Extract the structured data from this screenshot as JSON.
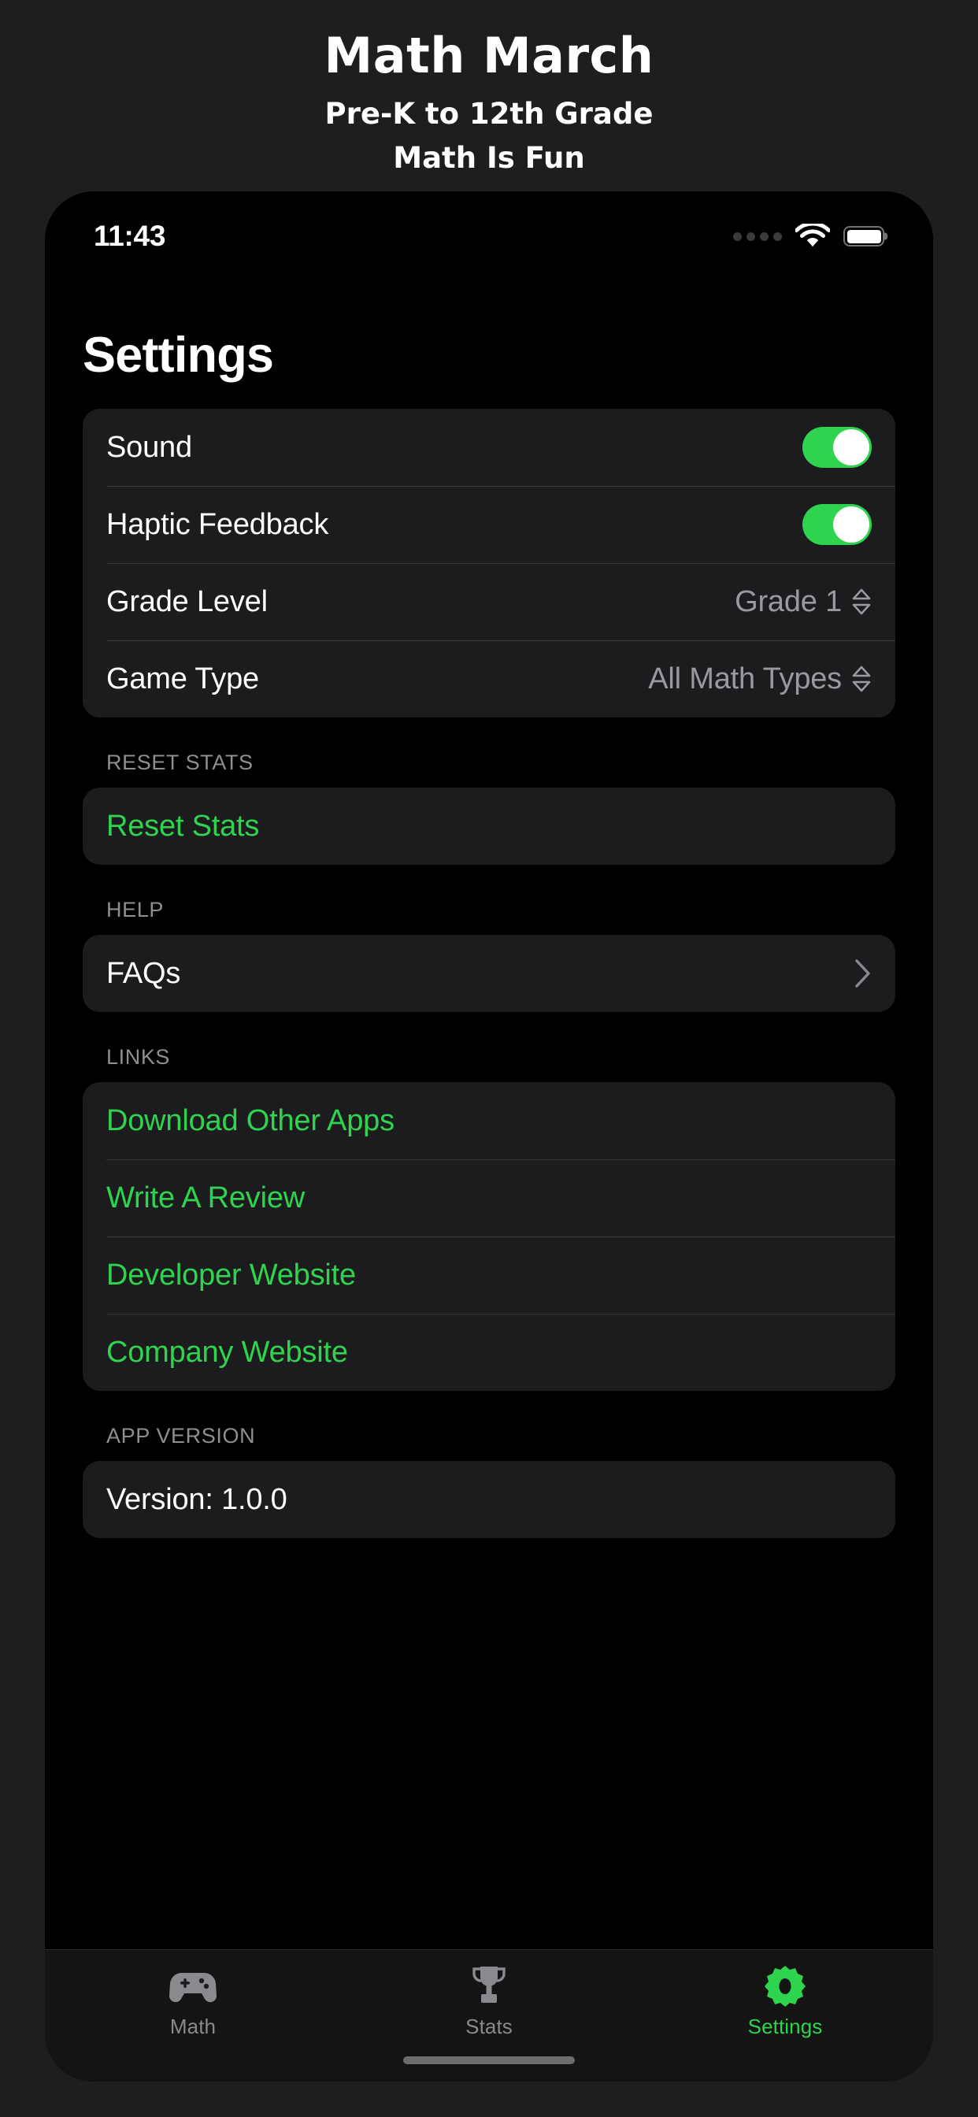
{
  "promo": {
    "title": "Math March",
    "subtitle_line1": "Pre-K to 12th Grade",
    "subtitle_line2": "Math Is Fun"
  },
  "statusbar": {
    "time": "11:43",
    "signal_icon": "cellular-signal-icon",
    "wifi_icon": "wifi-icon",
    "battery_icon": "battery-full-icon"
  },
  "screen": {
    "title": "Settings"
  },
  "settings_card": {
    "rows": [
      {
        "label": "Sound",
        "type": "toggle",
        "value": "on"
      },
      {
        "label": "Haptic Feedback",
        "type": "toggle",
        "value": "on"
      },
      {
        "label": "Grade Level",
        "type": "picker",
        "value": "Grade 1"
      },
      {
        "label": "Game Type",
        "type": "picker",
        "value": "All Math Types"
      }
    ]
  },
  "reset_section": {
    "header": "RESET STATS",
    "rows": [
      {
        "label": "Reset Stats"
      }
    ]
  },
  "help_section": {
    "header": "HELP",
    "rows": [
      {
        "label": "FAQs"
      }
    ]
  },
  "links_section": {
    "header": "LINKS",
    "rows": [
      {
        "label": "Download Other Apps"
      },
      {
        "label": "Write A Review"
      },
      {
        "label": "Developer Website"
      },
      {
        "label": "Company Website"
      }
    ]
  },
  "version_section": {
    "header": "APP VERSION",
    "rows": [
      {
        "label": "Version: 1.0.0"
      }
    ]
  },
  "tabbar": {
    "tabs": [
      {
        "label": "Math",
        "icon": "gamepad-icon",
        "active": false
      },
      {
        "label": "Stats",
        "icon": "trophy-icon",
        "active": false
      },
      {
        "label": "Settings",
        "icon": "gear-icon",
        "active": true
      }
    ]
  },
  "colors": {
    "accent_green": "#2fd44e",
    "page_background": "#1e1e1e",
    "screen_background": "#000000",
    "card_background": "#1c1c1e",
    "secondary_text": "#8e8e93"
  }
}
